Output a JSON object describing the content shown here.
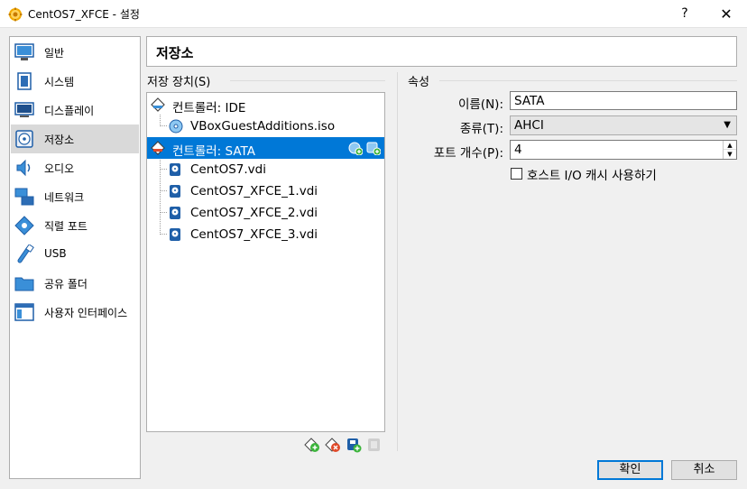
{
  "window": {
    "title": "CentOS7_XFCE - 설정",
    "help_label": "?",
    "close_label": "✕"
  },
  "sidebar": {
    "items": [
      {
        "label": "일반",
        "icon": "general-icon"
      },
      {
        "label": "시스템",
        "icon": "system-icon"
      },
      {
        "label": "디스플레이",
        "icon": "display-icon"
      },
      {
        "label": "저장소",
        "icon": "storage-icon",
        "selected": true
      },
      {
        "label": "오디오",
        "icon": "audio-icon"
      },
      {
        "label": "네트워크",
        "icon": "network-icon"
      },
      {
        "label": "직렬 포트",
        "icon": "serial-port-icon"
      },
      {
        "label": "USB",
        "icon": "usb-icon"
      },
      {
        "label": "공유 폴더",
        "icon": "shared-folder-icon"
      },
      {
        "label": "사용자 인터페이스",
        "icon": "user-interface-icon"
      }
    ]
  },
  "page": {
    "title": "저장소"
  },
  "storage": {
    "group_title": "저장 장치(S)",
    "tree": [
      {
        "label": "컨트롤러: IDE",
        "type": "controller"
      },
      {
        "label": "VBoxGuestAdditions.iso",
        "type": "optical"
      },
      {
        "label": "컨트롤러: SATA",
        "type": "controller",
        "selected": true
      },
      {
        "label": "CentOS7.vdi",
        "type": "disk"
      },
      {
        "label": "CentOS7_XFCE_1.vdi",
        "type": "disk"
      },
      {
        "label": "CentOS7_XFCE_2.vdi",
        "type": "disk"
      },
      {
        "label": "CentOS7_XFCE_3.vdi",
        "type": "disk"
      }
    ]
  },
  "attributes": {
    "group_title": "속성",
    "name_label": "이름(N):",
    "name_value": "SATA",
    "type_label": "종류(T):",
    "type_value": "AHCI",
    "port_label": "포트 개수(P):",
    "port_value": "4",
    "cache_label": "호스트 I/O 캐시 사용하기",
    "cache_checked": false
  },
  "buttons": {
    "ok": "확인",
    "cancel": "취소"
  },
  "colors": {
    "selection": "#0078d7",
    "sidebar_selected": "#d9d9d9"
  }
}
